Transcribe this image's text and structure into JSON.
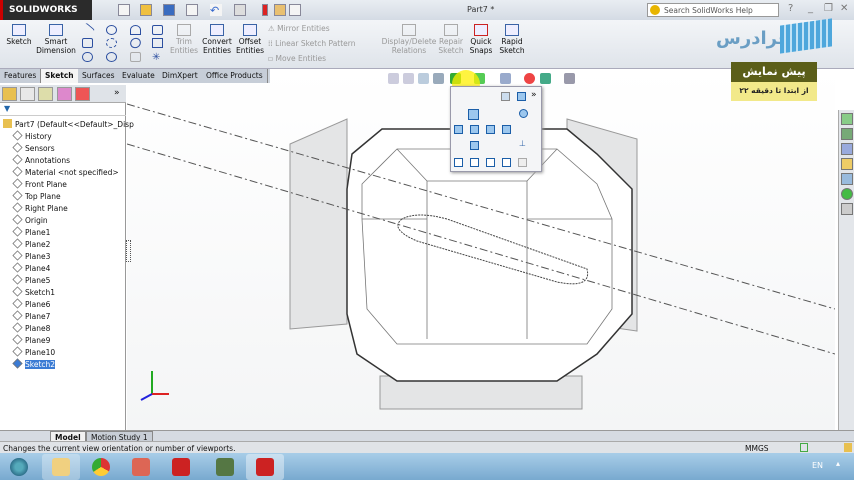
{
  "app": {
    "logo": "SOLIDWORKS",
    "document_title": "Part7 *",
    "search_placeholder": "Search SolidWorks Help",
    "window_controls": [
      "?",
      "_",
      "❐",
      "✕"
    ]
  },
  "ribbon": {
    "sketch": "Sketch",
    "smart_dimension": "Smart Dimension",
    "trim_entities": "Trim Entities",
    "convert_entities": "Convert Entities",
    "offset_entities": "Offset Entities",
    "mirror_entities": "Mirror Entities",
    "linear_sketch_pattern": "Linear Sketch Pattern",
    "move_entities": "Move Entities",
    "display_delete_relations": "Display/Delete Relations",
    "repair_sketch": "Repair Sketch",
    "quick_snaps": "Quick Snaps",
    "rapid_sketch": "Rapid Sketch"
  },
  "tabs": [
    "Features",
    "Sketch",
    "Surfaces",
    "Evaluate",
    "DimXpert",
    "Office Products"
  ],
  "active_tab": "Sketch",
  "tree": {
    "root": "Part7  (Default<<Default>_Disp",
    "items": [
      "History",
      "Sensors",
      "Annotations",
      "Material <not specified>",
      "Front Plane",
      "Top Plane",
      "Right Plane",
      "Origin",
      "Plane1",
      "Plane2",
      "Plane3",
      "Plane4",
      "Plane5",
      "Sketch1",
      "Plane6",
      "Plane7",
      "Plane8",
      "Plane9",
      "Plane10",
      "Sketch2"
    ],
    "selected": "Sketch2"
  },
  "banner": {
    "title": "پیش نمایش",
    "subtitle": "از ابتدا تا دقیقه ۲۲",
    "brand": "فرادرس"
  },
  "bottom_tabs": [
    "Model",
    "Motion Study 1"
  ],
  "status": {
    "message": "Changes the current view orientation or number of viewports.",
    "units": "MMGS"
  },
  "taskbar": {
    "language": "EN",
    "apps": [
      "explorer",
      "chrome",
      "powerpoint",
      "solidworks",
      "camtasia",
      "solidworks-active"
    ]
  }
}
